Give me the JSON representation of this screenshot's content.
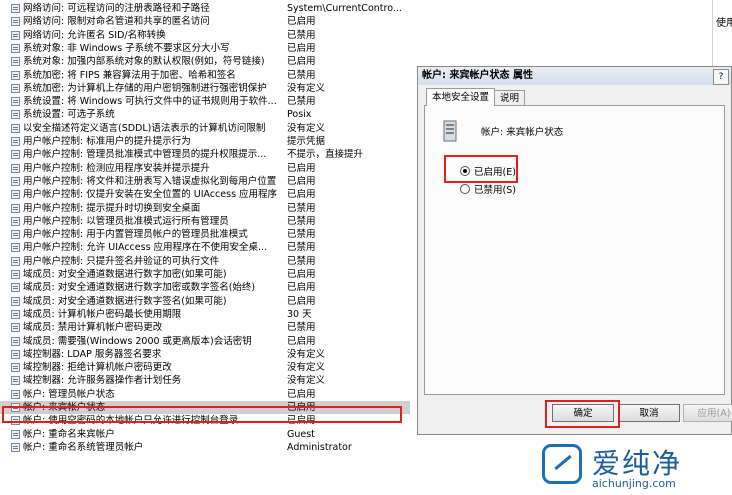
{
  "policies": [
    {
      "name": "网络访问: 可远程访问的注册表路径和子路径",
      "value": "System\\CurrentContro..."
    },
    {
      "name": "网络访问: 限制对命名管道和共享的匿名访问",
      "value": "已启用"
    },
    {
      "name": "网络访问: 允许匿名 SID/名称转换",
      "value": "已禁用"
    },
    {
      "name": "系统对象: 非 Windows 子系统不要求区分大小写",
      "value": "已启用"
    },
    {
      "name": "系统对象: 加强内部系统对象的默认权限(例如，符号链接)",
      "value": "已启用"
    },
    {
      "name": "系统加密: 将 FIPS 兼容算法用于加密、哈希和签名",
      "value": "已禁用"
    },
    {
      "name": "系统加密: 为计算机上存储的用户密钥强制进行强密钥保护",
      "value": "没有定义"
    },
    {
      "name": "系统设置: 将 Windows 可执行文件中的证书规则用于软件...",
      "value": "已禁用"
    },
    {
      "name": "系统设置: 可选子系统",
      "value": "Posix"
    },
    {
      "name": "以安全描述符定义语言(SDDL)语法表示的计算机访问限制",
      "value": "没有定义"
    },
    {
      "name": "用户帐户控制: 标准用户的提升提示行为",
      "value": "提示凭据"
    },
    {
      "name": "用户帐户控制: 管理员批准模式中管理员的提升权限提示...",
      "value": "不提示，直接提升"
    },
    {
      "name": "用户帐户控制: 检测应用程序安装并提示提升",
      "value": "已启用"
    },
    {
      "name": "用户帐户控制: 将文件和注册表写入错误虚拟化到每用户位置",
      "value": "已启用"
    },
    {
      "name": "用户帐户控制: 仅提升安装在安全位置的 UIAccess 应用程序",
      "value": "已启用"
    },
    {
      "name": "用户帐户控制: 提示提升时切换到安全桌面",
      "value": "已禁用"
    },
    {
      "name": "用户帐户控制: 以管理员批准模式运行所有管理员",
      "value": "已禁用"
    },
    {
      "name": "用户帐户控制: 用于内置管理员帐户的管理员批准模式",
      "value": "已禁用"
    },
    {
      "name": "用户帐户控制: 允许 UIAccess 应用程序在不使用安全桌...",
      "value": "已禁用"
    },
    {
      "name": "用户帐户控制: 只提升签名并验证的可执行文件",
      "value": "已禁用"
    },
    {
      "name": "域成员: 对安全通道数据进行数字加密(如果可能)",
      "value": "已启用"
    },
    {
      "name": "域成员: 对安全通道数据进行数字加密或数字签名(始终)",
      "value": "已启用"
    },
    {
      "name": "域成员: 对安全通道数据进行数字签名(如果可能)",
      "value": "已启用"
    },
    {
      "name": "域成员: 计算机帐户密码最长使用期限",
      "value": "30 天"
    },
    {
      "name": "域成员: 禁用计算机帐户密码更改",
      "value": "已禁用"
    },
    {
      "name": "域成员: 需要强(Windows 2000 或更高版本)会话密钥",
      "value": "已启用"
    },
    {
      "name": "域控制器: LDAP 服务器签名要求",
      "value": "没有定义"
    },
    {
      "name": "域控制器: 拒绝计算机帐户密码更改",
      "value": "没有定义"
    },
    {
      "name": "域控制器: 允许服务器操作者计划任务",
      "value": "没有定义"
    },
    {
      "name": "帐户: 管理员帐户状态",
      "value": "已启用"
    },
    {
      "name": "帐户: 来宾帐户状态",
      "value": "已启用"
    },
    {
      "name": "帐户: 使用空密码的本地帐户只允许进行控制台登录",
      "value": "已启用"
    },
    {
      "name": "帐户: 重命名来宾帐户",
      "value": "Guest"
    },
    {
      "name": "帐户: 重命名系统管理员帐户",
      "value": "Administrator"
    }
  ],
  "dialog": {
    "title": "帐户: 来宾帐户状态 属性",
    "help": "?",
    "tabs": [
      "本地安全设置",
      "说明"
    ],
    "policy_name": "帐户: 来宾帐户状态",
    "options": [
      {
        "label": "已启用(E)",
        "checked": true
      },
      {
        "label": "已禁用(S)",
        "checked": false
      }
    ],
    "buttons": {
      "ok": "确定",
      "cancel": "取消",
      "apply": "应用(A)"
    }
  },
  "side_text": "使用技巧",
  "watermark": {
    "brand": "爱纯净",
    "url": "aichunjing.com",
    "brand_color": "#1a5e9e"
  },
  "highlight_color": "#e02020"
}
